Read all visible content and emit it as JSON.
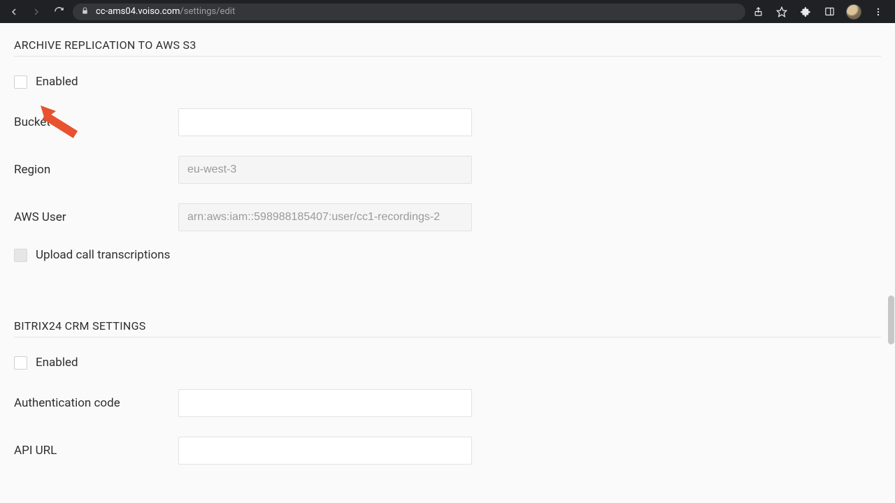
{
  "browser": {
    "url_host": "cc-ams04.voiso.com",
    "url_path": "/settings/edit"
  },
  "sections": {
    "s3": {
      "title": "ARCHIVE REPLICATION TO AWS S3",
      "enabled_label": "Enabled",
      "bucket_label": "Bucket",
      "bucket_value": "",
      "region_label": "Region",
      "region_value": "eu-west-3",
      "aws_user_label": "AWS User",
      "aws_user_value": "arn:aws:iam::598988185407:user/cc1-recordings-2",
      "upload_trans_label": "Upload call transcriptions"
    },
    "bitrix": {
      "title": "BITRIX24 CRM SETTINGS",
      "enabled_label": "Enabled",
      "auth_label": "Authentication code",
      "auth_value": "",
      "api_label": "API URL",
      "api_value": ""
    }
  }
}
